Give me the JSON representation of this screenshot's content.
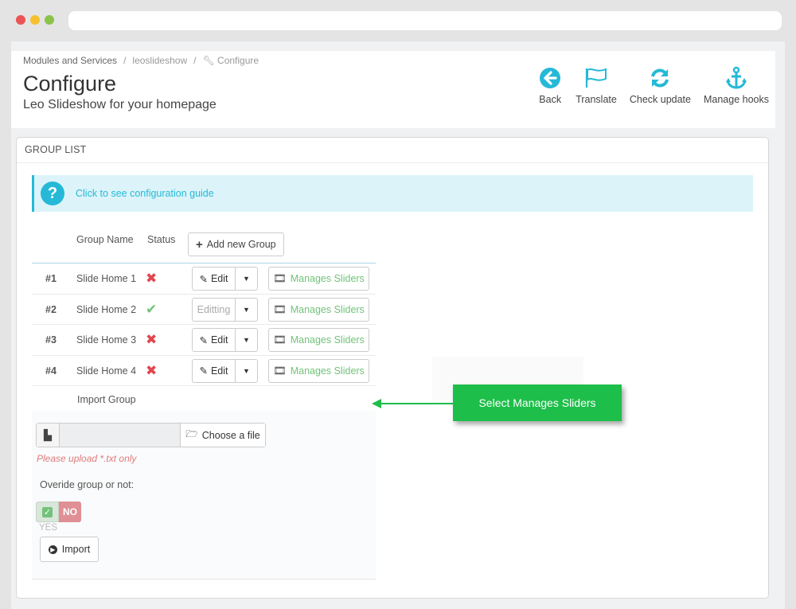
{
  "breadcrumb": {
    "modules": "Modules and Services",
    "module": "leoslideshow",
    "current": "Configure"
  },
  "header": {
    "title": "Configure",
    "subtitle": "Leo Slideshow for your homepage"
  },
  "toolbar": [
    {
      "label": "Back",
      "icon": "arrow-left-circle-icon"
    },
    {
      "label": "Translate",
      "icon": "flag-icon"
    },
    {
      "label": "Check update",
      "icon": "refresh-icon"
    },
    {
      "label": "Manage hooks",
      "icon": "anchor-icon"
    }
  ],
  "panel": {
    "heading": "GROUP LIST"
  },
  "alert": {
    "link": "Click to see configuration guide"
  },
  "table": {
    "col_name": "Group Name",
    "col_status": "Status",
    "add_label": "Add new Group",
    "rows": [
      {
        "num": "#1",
        "name": "Slide Home 1",
        "status": "inactive",
        "edit": "Edit",
        "manage": "Manages Sliders"
      },
      {
        "num": "#2",
        "name": "Slide Home 2",
        "status": "active",
        "edit": "Editting",
        "manage": "Manages Sliders"
      },
      {
        "num": "#3",
        "name": "Slide Home 3",
        "status": "inactive",
        "edit": "Edit",
        "manage": "Manages Sliders"
      },
      {
        "num": "#4",
        "name": "Slide Home 4",
        "status": "inactive",
        "edit": "Edit",
        "manage": "Manages Sliders"
      }
    ],
    "import_group": "Import Group"
  },
  "import": {
    "choose": "Choose a file",
    "hint": "Please upload *.txt only",
    "override": "Overide group or not:",
    "no": "NO",
    "yes": "YES",
    "button": "Import"
  },
  "callout": "Select Manages Sliders",
  "colors": {
    "accent": "#25b9d7",
    "success": "#72c279",
    "danger": "#e3454f",
    "callout": "#1ebe4a"
  }
}
